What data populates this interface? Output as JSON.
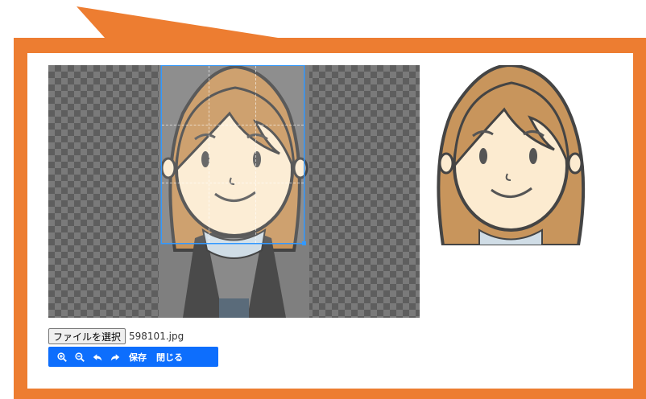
{
  "file": {
    "choose_label": "ファイルを選択",
    "file_name": "598101.jpg"
  },
  "toolbar": {
    "zoom_in_icon": "zoom-in-icon",
    "zoom_out_icon": "zoom-out-icon",
    "rotate_left_icon": "rotate-left-icon",
    "rotate_right_icon": "rotate-right-icon",
    "save_label": "保存",
    "close_label": "閉じる"
  },
  "colors": {
    "frame": "#ED7D31",
    "toolbar": "#0d6efd",
    "crop_border": "#3399ff"
  }
}
